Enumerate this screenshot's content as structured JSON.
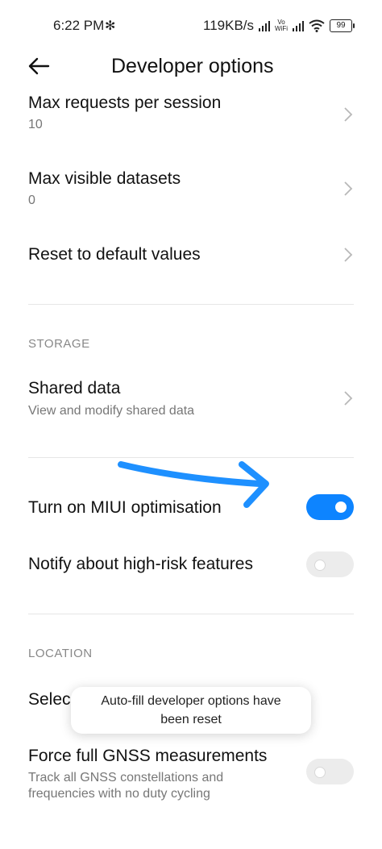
{
  "status_bar": {
    "time": "6:22 PM",
    "speed": "119KB/s",
    "vowifi_top": "Vo",
    "vowifi_bottom": "WiFi",
    "battery": "99"
  },
  "header": {
    "title": "Developer options",
    "back_icon": "back-arrow-icon"
  },
  "items": {
    "max_requests": {
      "title": "Max requests per session",
      "value": "10"
    },
    "max_visible": {
      "title": "Max visible datasets",
      "value": "0"
    },
    "reset": {
      "title": "Reset to default values"
    },
    "storage_section": "STORAGE",
    "shared_data": {
      "title": "Shared data",
      "subtitle": "View and modify shared data"
    },
    "miui_opt": {
      "title": "Turn on MIUI optimisation",
      "enabled": true
    },
    "high_risk": {
      "title": "Notify about high-risk features",
      "enabled": false
    },
    "location_section": "LOCATION",
    "select_mock": {
      "title_visible": "Selec"
    },
    "gnss": {
      "title": "Force full GNSS measurements",
      "subtitle_line1": "Track all GNSS constellations and",
      "subtitle_line2": "frequencies with no duty cycling",
      "enabled": false
    }
  },
  "toast": {
    "line1": "Auto-fill developer options have",
    "line2": "been reset"
  },
  "colors": {
    "accent": "#0d84ff",
    "annotation": "#1e90ff"
  }
}
